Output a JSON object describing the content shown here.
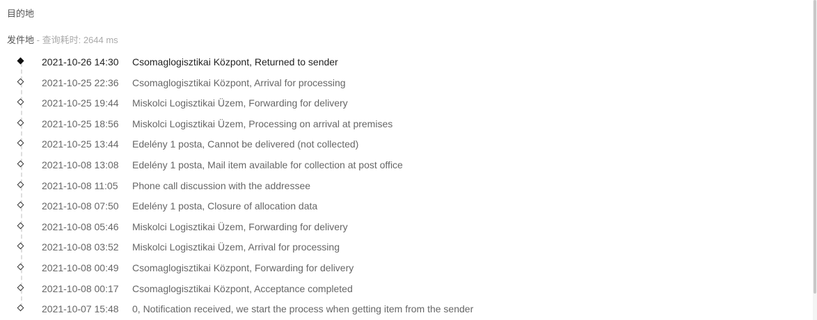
{
  "destination": {
    "label": "目的地"
  },
  "origin": {
    "label": "发件地",
    "separator": " - ",
    "query_time_label": "查询耗时: ",
    "query_time_value": "2644",
    "query_time_unit": " ms"
  },
  "events": [
    {
      "time": "2021-10-26 14:30",
      "description": "Csomaglogisztikai Központ, Returned to sender"
    },
    {
      "time": "2021-10-25 22:36",
      "description": "Csomaglogisztikai Központ, Arrival for processing"
    },
    {
      "time": "2021-10-25 19:44",
      "description": "Miskolci Logisztikai Üzem, Forwarding for delivery"
    },
    {
      "time": "2021-10-25 18:56",
      "description": "Miskolci Logisztikai Üzem, Processing on arrival at premises"
    },
    {
      "time": "2021-10-25 13:44",
      "description": "Edelény 1 posta, Cannot be delivered (not collected)"
    },
    {
      "time": "2021-10-08 13:08",
      "description": "Edelény 1 posta, Mail item available for collection at post office"
    },
    {
      "time": "2021-10-08 11:05",
      "description": "Phone call discussion with the addressee"
    },
    {
      "time": "2021-10-08 07:50",
      "description": "Edelény 1 posta, Closure of allocation data"
    },
    {
      "time": "2021-10-08 05:46",
      "description": "Miskolci Logisztikai Üzem, Forwarding for delivery"
    },
    {
      "time": "2021-10-08 03:52",
      "description": "Miskolci Logisztikai Üzem, Arrival for processing"
    },
    {
      "time": "2021-10-08 00:49",
      "description": "Csomaglogisztikai Központ, Forwarding for delivery"
    },
    {
      "time": "2021-10-08 00:17",
      "description": "Csomaglogisztikai Központ, Acceptance completed"
    },
    {
      "time": "2021-10-07 15:48",
      "description": "0, Notification received, we start the process when getting item from the sender"
    }
  ],
  "icons": {
    "current_marker": "filled-diamond-icon",
    "past_marker": "hollow-diamond-icon"
  }
}
